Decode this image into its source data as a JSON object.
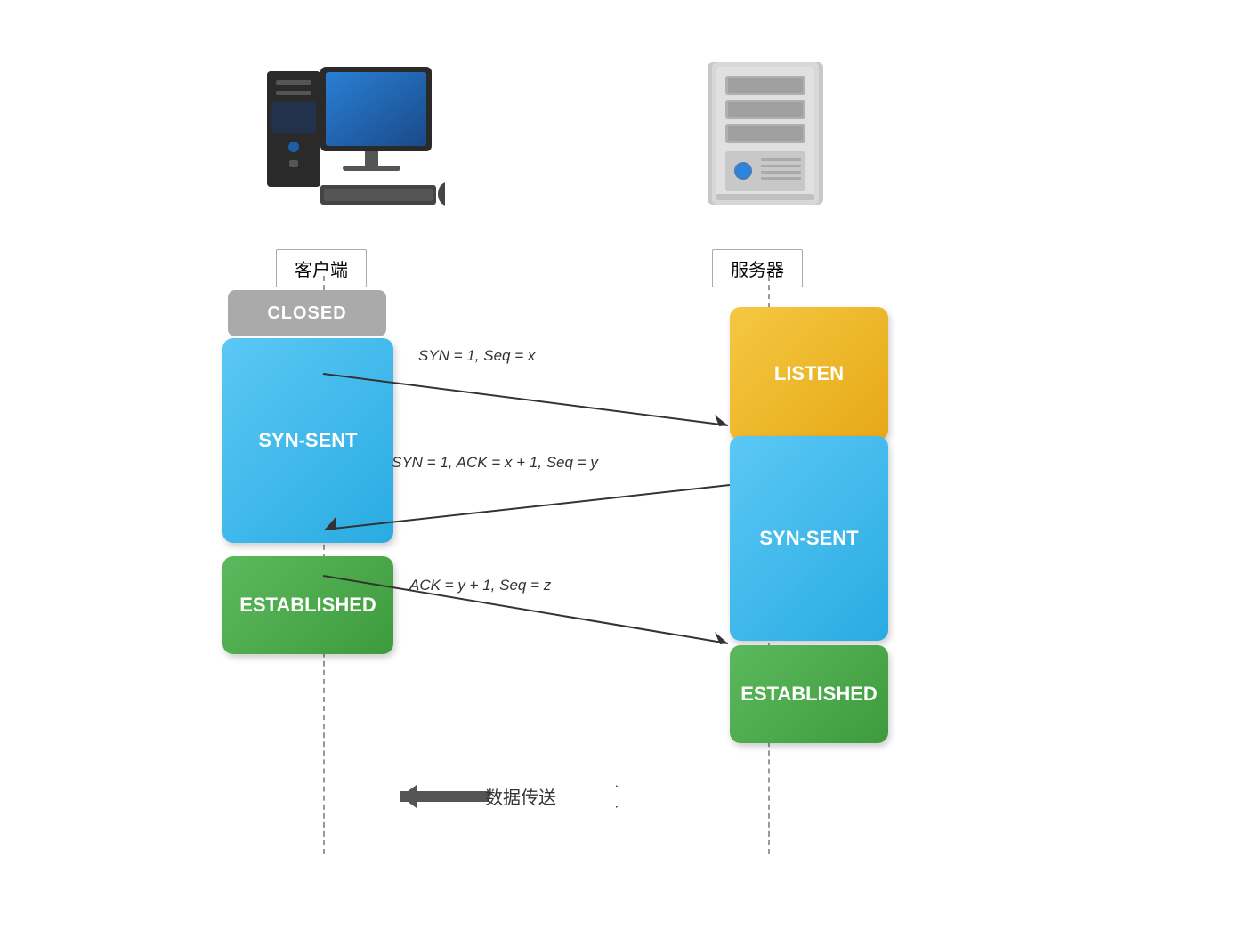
{
  "client": {
    "label": "客户端",
    "icon_alt": "client-computer"
  },
  "server": {
    "label": "服务器",
    "icon_alt": "server"
  },
  "states": {
    "closed": "CLOSED",
    "syn_sent_client": "SYN-SENT",
    "established_client": "ESTABLISHED",
    "listen": "LISTEN",
    "syn_sent_server": "SYN-SENT",
    "established_server": "ESTABLISHED"
  },
  "arrows": {
    "first": "SYN = 1, Seq = x",
    "second": "SYN = 1, ACK = x + 1, Seq = y",
    "third": "ACK = y + 1, Seq = z"
  },
  "data_transfer": {
    "label": "数据传送"
  },
  "colors": {
    "blue": "#29abe2",
    "green": "#3d9b3d",
    "yellow": "#e6a817",
    "gray": "#aaaaaa"
  }
}
